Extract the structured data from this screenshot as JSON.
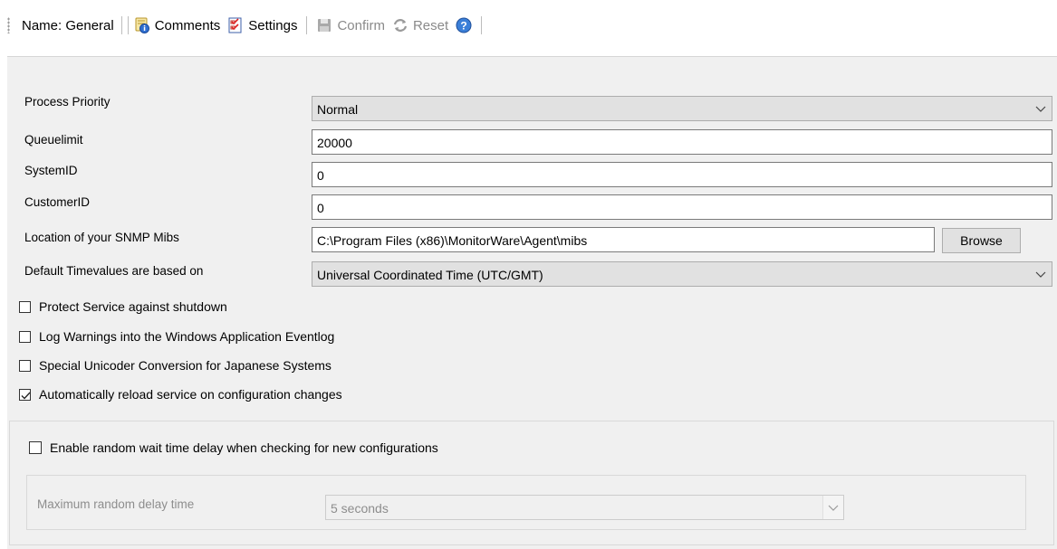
{
  "toolbar": {
    "name_label": "Name: General",
    "comments_label": "Comments",
    "settings_label": "Settings",
    "confirm_label": "Confirm",
    "reset_label": "Reset"
  },
  "form": {
    "process_priority": {
      "label": "Process Priority",
      "value": "Normal"
    },
    "queuelimit": {
      "label": "Queuelimit",
      "value": "20000"
    },
    "system_id": {
      "label": "SystemID",
      "value": "0"
    },
    "customer_id": {
      "label": "CustomerID",
      "value": "0"
    },
    "snmp_mibs": {
      "label": "Location of your SNMP Mibs",
      "value": "C:\\Program Files (x86)\\MonitorWare\\Agent\\mibs",
      "browse_label": "Browse"
    },
    "timevalues": {
      "label": "Default Timevalues are based on",
      "value": "Universal Coordinated Time (UTC/GMT)"
    }
  },
  "checkboxes": [
    {
      "label": "Protect Service against shutdown",
      "checked": false
    },
    {
      "label": "Log Warnings into the Windows Application Eventlog",
      "checked": false
    },
    {
      "label": "Special Unicoder Conversion for Japanese Systems",
      "checked": false
    },
    {
      "label": "Automatically reload service on configuration changes",
      "checked": true
    }
  ],
  "random_wait": {
    "label": "Enable random wait time delay when checking for new configurations",
    "checked": false,
    "delay_label": "Maximum random delay time",
    "delay_value": "5 seconds"
  },
  "colors": {
    "panel_bg": "#f0f0f0",
    "combo_bg": "#e1e1e1",
    "disabled_text": "#8d8d8d"
  }
}
